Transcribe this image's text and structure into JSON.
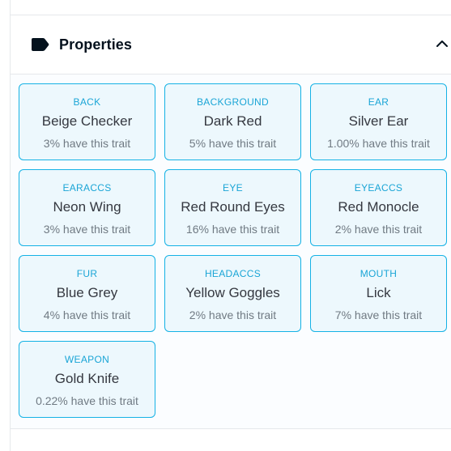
{
  "section": {
    "title": "Properties",
    "icon": "tag-icon",
    "toggle_icon": "chevron-up-icon"
  },
  "colors": {
    "accent": "#15b2e5",
    "title": "#04111d",
    "value": "#353840",
    "muted": "#707a83"
  },
  "traits": [
    {
      "type": "BACK",
      "value": "Beige Checker",
      "rarity": "3% have this trait"
    },
    {
      "type": "BACKGROUND",
      "value": "Dark Red",
      "rarity": "5% have this trait"
    },
    {
      "type": "EAR",
      "value": "Silver Ear",
      "rarity": "1.00% have this trait"
    },
    {
      "type": "EARACCS",
      "value": "Neon Wing",
      "rarity": "3% have this trait"
    },
    {
      "type": "EYE",
      "value": "Red Round Eyes",
      "rarity": "16% have this trait"
    },
    {
      "type": "EYEACCS",
      "value": "Red Monocle",
      "rarity": "2% have this trait"
    },
    {
      "type": "FUR",
      "value": "Blue Grey",
      "rarity": "4% have this trait"
    },
    {
      "type": "HEADACCS",
      "value": "Yellow Goggles",
      "rarity": "2% have this trait"
    },
    {
      "type": "MOUTH",
      "value": "Lick",
      "rarity": "7% have this trait"
    },
    {
      "type": "WEAPON",
      "value": "Gold Knife",
      "rarity": "0.22% have this trait"
    }
  ]
}
